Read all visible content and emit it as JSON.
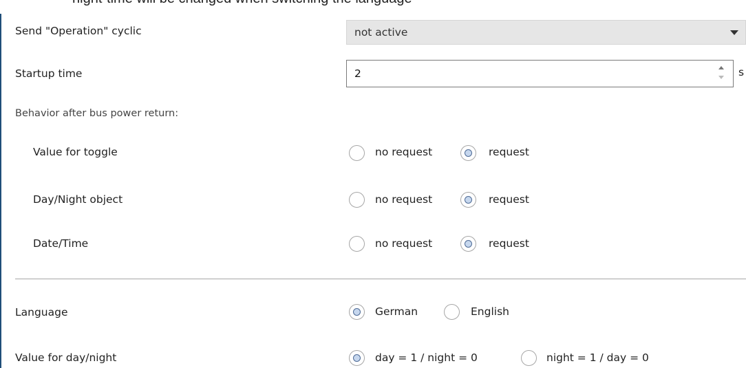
{
  "top_clip_text": "night-time will be changed when switching the language",
  "send_operation": {
    "label": "Send \"Operation\" cyclic",
    "value": "not active"
  },
  "startup": {
    "label": "Startup time",
    "value": "2",
    "unit": "s"
  },
  "bus_power_section": {
    "heading": "Behavior after bus power return:",
    "rows": [
      {
        "label": "Value for toggle",
        "options": [
          "no request",
          "request"
        ],
        "selected": "request"
      },
      {
        "label": "Day/Night object",
        "options": [
          "no request",
          "request"
        ],
        "selected": "request"
      },
      {
        "label": "Date/Time",
        "options": [
          "no request",
          "request"
        ],
        "selected": "request"
      }
    ]
  },
  "language": {
    "label": "Language",
    "options": [
      "German",
      "English"
    ],
    "selected": "German"
  },
  "day_night": {
    "label": "Value for day/night",
    "options": [
      "day = 1 / night = 0",
      "night = 1 / day = 0"
    ],
    "selected": "day = 1 / night = 0"
  }
}
